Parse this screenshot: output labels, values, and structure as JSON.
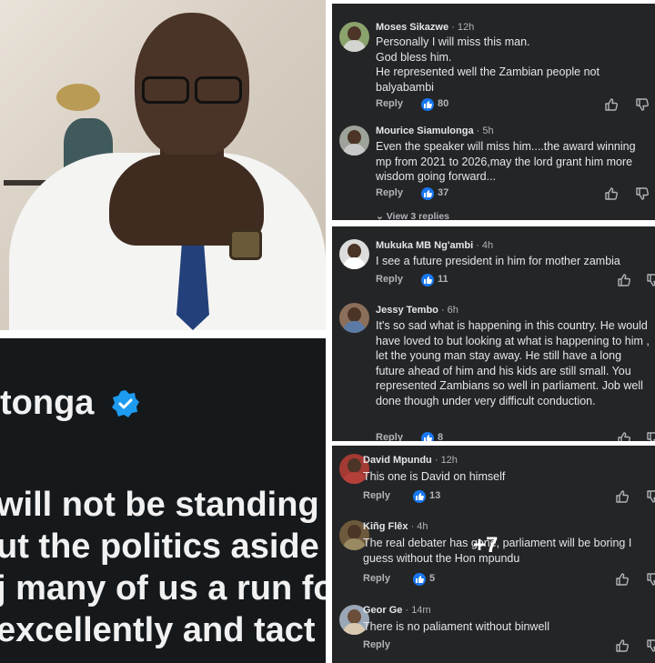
{
  "tweet": {
    "name": "tonga",
    "lines": [
      "will not be standing",
      "ut the politics aside",
      "j many of us a run fo",
      "excellently and tact"
    ]
  },
  "comments_top": [
    {
      "name": "Moses Sikazwe",
      "time": "· 12h",
      "text": "Personally I will miss this man.\nGod bless him.\nHe represented well the Zambian people not balyabambi",
      "reply": "Reply",
      "likes": "80"
    },
    {
      "name": "Mourice Siamulonga",
      "time": "· 5h",
      "text": "Even the speaker will miss him....the award winning mp from 2021 to 2026,may the lord grant him more wisdom going forward...",
      "reply": "Reply",
      "likes": "37",
      "view_replies": "View 3 replies"
    }
  ],
  "comments_mid": [
    {
      "name": "Mukuka MB Ng'ambi",
      "time": "· 4h",
      "text": "I see a future president in him for mother zambia",
      "reply": "Reply",
      "likes": "11"
    },
    {
      "name": "Jessy Tembo",
      "time": "· 6h",
      "text": "It's so sad what is happening in this country. He would have loved to but looking at what is happening to him , let the young man stay away. He still have a long future ahead of him and his kids are still small. You represented Zambians so well in parliament. Job well done though under very difficult conduction.",
      "reply": "Reply",
      "likes": "8"
    }
  ],
  "comments_bottom": [
    {
      "name": "David Mpundu",
      "time": "· 12h",
      "text": "This one is David on himself",
      "reply": "Reply",
      "likes": "13"
    },
    {
      "name": "Kiñg Flêx",
      "time": "· 4h",
      "text": "The real debater has gone, parliament will be boring I guess without the Hon mpundu",
      "reply": "Reply",
      "likes": "5"
    },
    {
      "name": "Geor Ge",
      "time": "· 14m",
      "text": "There is no paliament without binwell",
      "reply": "Reply",
      "likes": ""
    }
  ],
  "overlay": {
    "more_count": "+7"
  },
  "colors": {
    "panel_bg": "#242526",
    "text_primary": "#e4e6eb",
    "text_secondary": "#b0b3b8",
    "like_blue": "#1877f2",
    "verified_blue": "#1d9bf0"
  }
}
